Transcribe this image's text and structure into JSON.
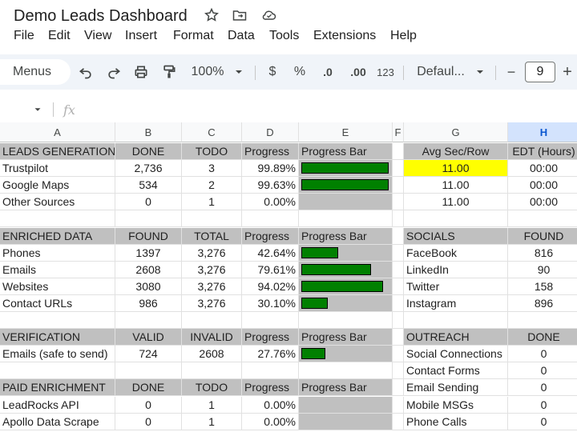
{
  "title": "Demo Leads Dashboard",
  "menu": [
    "File",
    "Edit",
    "View",
    "Insert",
    "Format",
    "Data",
    "Tools",
    "Extensions",
    "Help"
  ],
  "toolbar": {
    "menus_label": "Menus",
    "zoom": "100%",
    "currency": "$",
    "percent": "%",
    "dec_decrease": ".0",
    "dec_increase": ".00",
    "number_format": "123",
    "font": "Defaul...",
    "font_size": "9",
    "minus": "−",
    "plus": "+"
  },
  "formula": {
    "fx": "fx"
  },
  "columns": [
    "A",
    "B",
    "C",
    "D",
    "E",
    "F",
    "G",
    "H"
  ],
  "rows": [
    {
      "type": "header",
      "a": "LEADS GENERATION",
      "b": "DONE",
      "c": "TODO",
      "d": "Progress",
      "e": "Progress Bar",
      "g": "Avg Sec/Row",
      "h": "EDT (Hours)",
      "gh_header": true
    },
    {
      "type": "data",
      "a": "Trustpilot",
      "b": "2,736",
      "c": "3",
      "d": "99.89%",
      "bar": 0.9989,
      "g": "11.00",
      "h": "00:00",
      "g_yellow": true
    },
    {
      "type": "data",
      "a": "Google Maps",
      "b": "534",
      "c": "2",
      "d": "99.63%",
      "bar": 0.9963,
      "g": "11.00",
      "h": "00:00"
    },
    {
      "type": "data",
      "a": "Other Sources",
      "b": "0",
      "c": "1",
      "d": "0.00%",
      "bar": 0,
      "g": "11.00",
      "h": "00:00"
    },
    {
      "type": "blank"
    },
    {
      "type": "header",
      "a": "ENRICHED DATA",
      "b": "FOUND",
      "c": "TOTAL",
      "d": "Progress",
      "e": "Progress Bar",
      "g": "SOCIALS",
      "h": "FOUND",
      "gh_header": true,
      "g_left": true
    },
    {
      "type": "data",
      "a": "Phones",
      "b": "1397",
      "c": "3,276",
      "d": "42.64%",
      "bar": 0.4264,
      "g": "FaceBook",
      "h": "816",
      "g_left": true
    },
    {
      "type": "data",
      "a": "Emails",
      "b": "2608",
      "c": "3,276",
      "d": "79.61%",
      "bar": 0.7961,
      "g": "LinkedIn",
      "h": "90",
      "g_left": true
    },
    {
      "type": "data",
      "a": "Websites",
      "b": "3080",
      "c": "3,276",
      "d": "94.02%",
      "bar": 0.9402,
      "g": "Twitter",
      "h": "158",
      "g_left": true
    },
    {
      "type": "data",
      "a": "Contact URLs",
      "b": "986",
      "c": "3,276",
      "d": "30.10%",
      "bar": 0.301,
      "g": "Instagram",
      "h": "896",
      "g_left": true
    },
    {
      "type": "blank"
    },
    {
      "type": "header",
      "a": "VERIFICATION",
      "b": "VALID",
      "c": "INVALID",
      "d": "Progress",
      "e": "Progress Bar",
      "g": "OUTREACH",
      "h": "DONE",
      "gh_header": true,
      "g_left": true
    },
    {
      "type": "data",
      "a": "Emails (safe to send)",
      "b": "724",
      "c": "2608",
      "d": "27.76%",
      "bar": 0.2776,
      "g": "Social Connections",
      "h": "0",
      "g_left": true
    },
    {
      "type": "blank",
      "g": "Contact Forms",
      "h": "0",
      "g_left": true
    },
    {
      "type": "header",
      "a": "PAID ENRICHMENT",
      "b": "DONE",
      "c": "TODO",
      "d": "Progress",
      "e": "Progress Bar",
      "g": "Email Sending",
      "h": "0",
      "g_left": true
    },
    {
      "type": "data",
      "a": "LeadRocks API",
      "b": "0",
      "c": "1",
      "d": "0.00%",
      "bar": 0,
      "g": "Mobile MSGs",
      "h": "0",
      "g_left": true
    },
    {
      "type": "data",
      "a": "Apollo Data Scrape",
      "b": "0",
      "c": "1",
      "d": "0.00%",
      "bar": 0,
      "g": "Phone Calls",
      "h": "0",
      "g_left": true
    }
  ]
}
